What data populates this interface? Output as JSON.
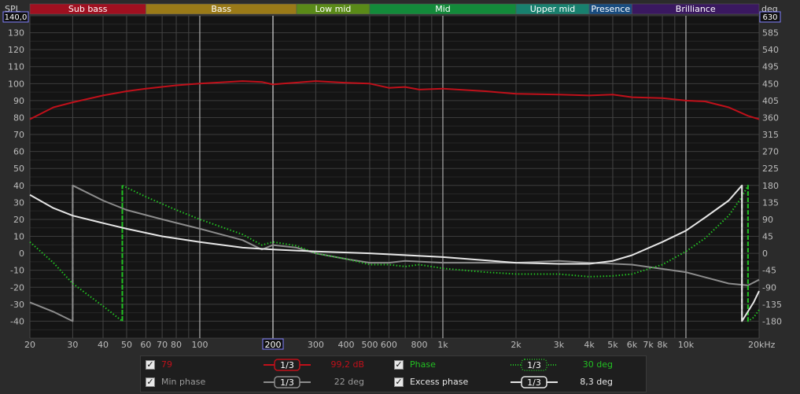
{
  "axes": {
    "left_unit": "SPL",
    "left_top_box": "140,0",
    "right_unit": "deg",
    "right_top_box": "630"
  },
  "bands": [
    {
      "label": "Sub bass",
      "from": 20,
      "to": 60,
      "color": "#a01020"
    },
    {
      "label": "Bass",
      "from": 60,
      "to": 250,
      "color": "#9a7a18"
    },
    {
      "label": "Low mid",
      "from": 250,
      "to": 500,
      "color": "#5a8a18"
    },
    {
      "label": "Mid",
      "from": 500,
      "to": 2000,
      "color": "#138a3a"
    },
    {
      "label": "Upper mid",
      "from": 2000,
      "to": 4000,
      "color": "#18806e"
    },
    {
      "label": "Presence",
      "from": 4000,
      "to": 6000,
      "color": "#184c80"
    },
    {
      "label": "Brilliance",
      "from": 6000,
      "to": 20000,
      "color": "#3a1860"
    }
  ],
  "cursor": {
    "freq": 200,
    "label": "200"
  },
  "chart_data": {
    "type": "line",
    "xscale": "log",
    "xlim": [
      20,
      20000
    ],
    "ylim_left": [
      -50,
      140
    ],
    "ylim_right": [
      -225,
      630
    ],
    "y_ticks_left": [
      "130",
      "120",
      "110",
      "100",
      "90",
      "80",
      "70",
      "60",
      "50",
      "40",
      "30",
      "20",
      "10",
      "0",
      "-10",
      "-20",
      "-30",
      "-40"
    ],
    "y_ticks_right": [
      "585",
      "540",
      "495",
      "450",
      "405",
      "360",
      "315",
      "270",
      "225",
      "180",
      "135",
      "90",
      "45",
      "0",
      "-45",
      "-90",
      "-135",
      "-180"
    ],
    "x_ticks": [
      {
        "f": 20,
        "label": "20"
      },
      {
        "f": 30,
        "label": "30"
      },
      {
        "f": 40,
        "label": "40"
      },
      {
        "f": 50,
        "label": "50"
      },
      {
        "f": 60,
        "label": "60"
      },
      {
        "f": 70,
        "label": "70"
      },
      {
        "f": 80,
        "label": "80"
      },
      {
        "f": 100,
        "label": "100"
      },
      {
        "f": 300,
        "label": "300"
      },
      {
        "f": 400,
        "label": "400"
      },
      {
        "f": 500,
        "label": "500"
      },
      {
        "f": 600,
        "label": "600"
      },
      {
        "f": 800,
        "label": "800"
      },
      {
        "f": 1000,
        "label": "1k"
      },
      {
        "f": 2000,
        "label": "2k"
      },
      {
        "f": 3000,
        "label": "3k"
      },
      {
        "f": 4000,
        "label": "4k"
      },
      {
        "f": 5000,
        "label": "5k"
      },
      {
        "f": 6000,
        "label": "6k"
      },
      {
        "f": 7000,
        "label": "7k"
      },
      {
        "f": 8000,
        "label": "8k"
      },
      {
        "f": 10000,
        "label": "10k"
      },
      {
        "f": 20000,
        "label": "20kHz"
      }
    ],
    "series": [
      {
        "name": "79",
        "axis": "left",
        "color": "#c0101a",
        "style": "solid",
        "points": [
          [
            20,
            79
          ],
          [
            25,
            86
          ],
          [
            30,
            89
          ],
          [
            40,
            93
          ],
          [
            50,
            95.5
          ],
          [
            60,
            97
          ],
          [
            80,
            99
          ],
          [
            100,
            100
          ],
          [
            150,
            101.5
          ],
          [
            180,
            101
          ],
          [
            200,
            99.5
          ],
          [
            220,
            100
          ],
          [
            300,
            101.5
          ],
          [
            400,
            100.5
          ],
          [
            500,
            100
          ],
          [
            600,
            97.5
          ],
          [
            700,
            98
          ],
          [
            800,
            96.5
          ],
          [
            1000,
            97
          ],
          [
            1500,
            95.5
          ],
          [
            2000,
            94
          ],
          [
            3000,
            93.5
          ],
          [
            4000,
            93
          ],
          [
            5000,
            93.5
          ],
          [
            6000,
            92
          ],
          [
            8000,
            91.5
          ],
          [
            10000,
            90
          ],
          [
            12000,
            89.5
          ],
          [
            15000,
            86
          ],
          [
            18000,
            81
          ],
          [
            20000,
            79
          ]
        ]
      },
      {
        "name": "Min phase",
        "axis": "right",
        "color": "#8c8c8c",
        "style": "solid",
        "points": [
          [
            20,
            -130
          ],
          [
            25,
            -155
          ],
          [
            30,
            -180
          ],
          [
            30,
            180
          ],
          [
            40,
            140
          ],
          [
            50,
            115
          ],
          [
            70,
            90
          ],
          [
            100,
            65
          ],
          [
            150,
            35
          ],
          [
            180,
            10
          ],
          [
            200,
            22
          ],
          [
            250,
            15
          ],
          [
            300,
            0
          ],
          [
            400,
            -15
          ],
          [
            500,
            -25
          ],
          [
            600,
            -25
          ],
          [
            700,
            -20
          ],
          [
            1000,
            -25
          ],
          [
            2000,
            -25
          ],
          [
            3000,
            -20
          ],
          [
            4000,
            -25
          ],
          [
            6000,
            -30
          ],
          [
            10000,
            -50
          ],
          [
            15000,
            -80
          ],
          [
            18000,
            -85
          ],
          [
            20000,
            -70
          ]
        ]
      },
      {
        "name": "Phase",
        "axis": "right",
        "color": "#22c022",
        "style": "dotted",
        "points": [
          [
            20,
            30
          ],
          [
            25,
            -25
          ],
          [
            30,
            -80
          ],
          [
            40,
            -140
          ],
          [
            48,
            -180
          ],
          [
            48,
            180
          ],
          [
            60,
            150
          ],
          [
            80,
            115
          ],
          [
            100,
            90
          ],
          [
            150,
            50
          ],
          [
            180,
            22
          ],
          [
            200,
            30
          ],
          [
            250,
            20
          ],
          [
            300,
            0
          ],
          [
            400,
            -15
          ],
          [
            500,
            -30
          ],
          [
            600,
            -30
          ],
          [
            700,
            -35
          ],
          [
            800,
            -30
          ],
          [
            1000,
            -40
          ],
          [
            1500,
            -50
          ],
          [
            2000,
            -55
          ],
          [
            3000,
            -55
          ],
          [
            4000,
            -62
          ],
          [
            5000,
            -60
          ],
          [
            6000,
            -55
          ],
          [
            8000,
            -30
          ],
          [
            10000,
            5
          ],
          [
            12000,
            40
          ],
          [
            15000,
            100
          ],
          [
            17000,
            150
          ],
          [
            18000,
            180
          ],
          [
            18000,
            -180
          ],
          [
            19000,
            -170
          ],
          [
            20000,
            -150
          ]
        ]
      },
      {
        "name": "Excess phase",
        "axis": "right",
        "color": "#e6e6e6",
        "style": "solid",
        "points": [
          [
            20,
            155
          ],
          [
            25,
            120
          ],
          [
            30,
            100
          ],
          [
            40,
            80
          ],
          [
            50,
            65
          ],
          [
            70,
            45
          ],
          [
            100,
            30
          ],
          [
            150,
            15
          ],
          [
            200,
            10
          ],
          [
            300,
            5
          ],
          [
            500,
            0
          ],
          [
            1000,
            -10
          ],
          [
            2000,
            -25
          ],
          [
            3000,
            -28
          ],
          [
            4000,
            -28
          ],
          [
            5000,
            -20
          ],
          [
            6000,
            -5
          ],
          [
            8000,
            30
          ],
          [
            10000,
            60
          ],
          [
            12000,
            95
          ],
          [
            15000,
            140
          ],
          [
            17000,
            180
          ],
          [
            17000,
            -180
          ],
          [
            19000,
            -130
          ],
          [
            20000,
            -100
          ]
        ]
      }
    ]
  },
  "legend": {
    "rows": [
      {
        "name": "79",
        "smoothing": "1/3",
        "value": "99,2 dB",
        "color": "#c0101a"
      },
      {
        "name": "Phase",
        "smoothing": "1/3",
        "value": "30 deg",
        "color": "#22c022"
      },
      {
        "name": "Min phase",
        "smoothing": "1/3",
        "value": "22 deg",
        "color": "#8c8c8c"
      },
      {
        "name": "Excess phase",
        "smoothing": "1/3",
        "value": "8,3 deg",
        "color": "#e6e6e6"
      }
    ]
  }
}
